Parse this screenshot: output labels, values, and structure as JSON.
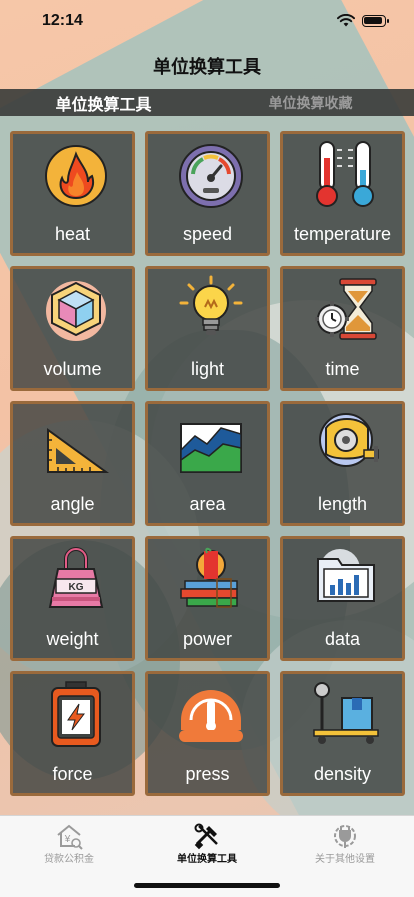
{
  "status": {
    "time": "12:14"
  },
  "nav": {
    "title": "单位换算工具"
  },
  "segments": [
    {
      "label": "单位换算工具",
      "active": true
    },
    {
      "label": "单位换算收藏",
      "active": false
    }
  ],
  "tiles": [
    {
      "label": "heat",
      "icon": "flame-icon"
    },
    {
      "label": "speed",
      "icon": "speedometer-icon"
    },
    {
      "label": "temperature",
      "icon": "thermometer-icon"
    },
    {
      "label": "volume",
      "icon": "cube-icon"
    },
    {
      "label": "light",
      "icon": "light-bulb-icon"
    },
    {
      "label": "time",
      "icon": "hourglass-icon"
    },
    {
      "label": "angle",
      "icon": "set-square-icon"
    },
    {
      "label": "area",
      "icon": "area-chart-icon"
    },
    {
      "label": "length",
      "icon": "tape-measure-icon"
    },
    {
      "label": "weight",
      "icon": "kettlebell-icon"
    },
    {
      "label": "power",
      "icon": "apple-books-icon"
    },
    {
      "label": "data",
      "icon": "folder-chart-icon"
    },
    {
      "label": "force",
      "icon": "battery-bolt-icon"
    },
    {
      "label": "press",
      "icon": "pressure-gauge-icon"
    },
    {
      "label": "density",
      "icon": "scale-box-icon"
    }
  ],
  "tile_icon_text": {
    "weight": "KG"
  },
  "tabbar": [
    {
      "label": "贷款公积金",
      "icon": "house-yen-icon",
      "active": false
    },
    {
      "label": "单位换算工具",
      "icon": "tools-icon",
      "active": true
    },
    {
      "label": "关于其他设置",
      "icon": "plug-settings-icon",
      "active": false
    }
  ],
  "colors": {
    "tile_border": "#9a6a3c",
    "tile_bg": "#3e4240",
    "segment_bg": "#3c3e3c",
    "accent": "#111111"
  }
}
